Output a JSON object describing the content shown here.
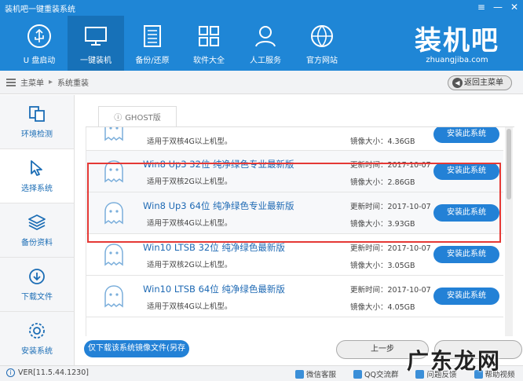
{
  "window": {
    "title": "装机吧一键重装系统",
    "controls": {
      "menu": "≡",
      "minimize": "—",
      "close": "✕"
    }
  },
  "nav": [
    {
      "label": "U 盘启动",
      "icon": "usb-icon"
    },
    {
      "label": "一键装机",
      "icon": "monitor-icon",
      "active": true
    },
    {
      "label": "备份/还原",
      "icon": "backup-icon"
    },
    {
      "label": "软件大全",
      "icon": "apps-grid-icon"
    },
    {
      "label": "人工服务",
      "icon": "person-icon"
    },
    {
      "label": "官方网站",
      "icon": "globe-icon"
    }
  ],
  "brand": {
    "name": "装机吧",
    "url": "zhuangjiba.com"
  },
  "breadcrumb": {
    "root": "主菜单",
    "current": "系统重装",
    "back_label": "返回主菜单"
  },
  "sidebar": [
    {
      "label": "环境检测",
      "icon": "environment-check-icon"
    },
    {
      "label": "选择系统",
      "icon": "cursor-icon",
      "active": true
    },
    {
      "label": "备份资料",
      "icon": "layers-icon"
    },
    {
      "label": "下载文件",
      "icon": "download-icon"
    },
    {
      "label": "安装系统",
      "icon": "settings-icon"
    }
  ],
  "tab": {
    "label": "GHOST版"
  },
  "systems": [
    {
      "name": "",
      "desc": "适用于双核4G以上机型。",
      "updated": "",
      "size": "镜像大小：4.36GB",
      "install": "安装此系统",
      "partial": true
    },
    {
      "name": "Win8 Up3 32位 纯净绿色专业最新版",
      "desc": "适用于双核2G以上机型。",
      "updated": "更新时间：2017-10-07",
      "size": "镜像大小：2.86GB",
      "install": "安装此系统",
      "highlight": true
    },
    {
      "name": "Win8 Up3 64位 纯净绿色专业最新版",
      "desc": "适用于双核4G以上机型。",
      "updated": "更新时间：2017-10-07",
      "size": "镜像大小：3.93GB",
      "install": "安装此系统",
      "highlight": true
    },
    {
      "name": "Win10 LTSB 32位 纯净绿色最新版",
      "desc": "适用于双核2G以上机型。",
      "updated": "更新时间：2017-10-07",
      "size": "镜像大小：3.05GB",
      "install": "安装此系统"
    },
    {
      "name": "Win10 LTSB 64位 纯净绿色最新版",
      "desc": "适用于双核4G以上机型。",
      "updated": "更新时间：2017-10-07",
      "size": "镜像大小：4.05GB",
      "install": "安装此系统"
    }
  ],
  "actions": {
    "download_only": "仅下载该系统镜像文件(另存为)",
    "prev": "上一步"
  },
  "footer": {
    "version": "VER[11.5.44.1230]",
    "links": [
      "微信客服",
      "QQ交流群",
      "问题反馈",
      "帮助视频"
    ]
  },
  "watermark": "广东龙网",
  "colors": {
    "primary": "#1f86d6",
    "button": "#2381d6",
    "highlight_border": "#e53935"
  }
}
